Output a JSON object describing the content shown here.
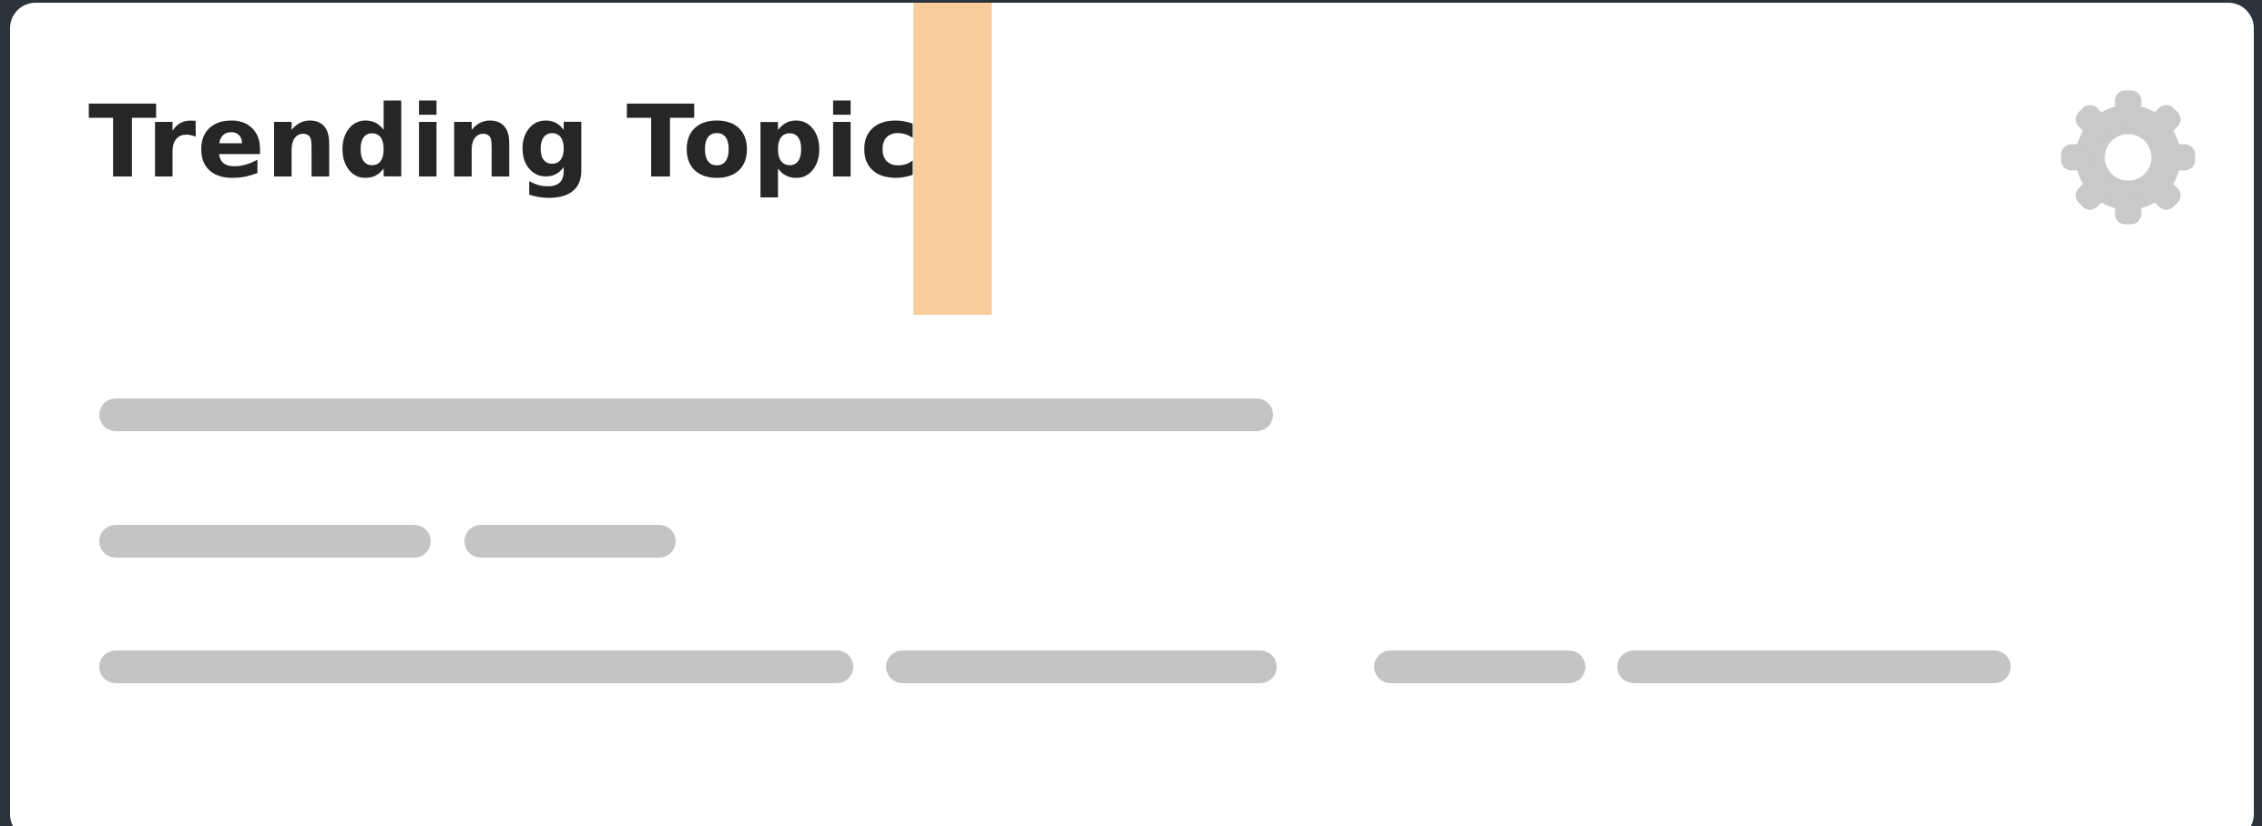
{
  "card": {
    "title": "Trending Topics",
    "settings_icon": "gear-icon",
    "highlight_color": "#f9cc9c"
  },
  "skeleton": {
    "color": "#c4c4c4"
  }
}
